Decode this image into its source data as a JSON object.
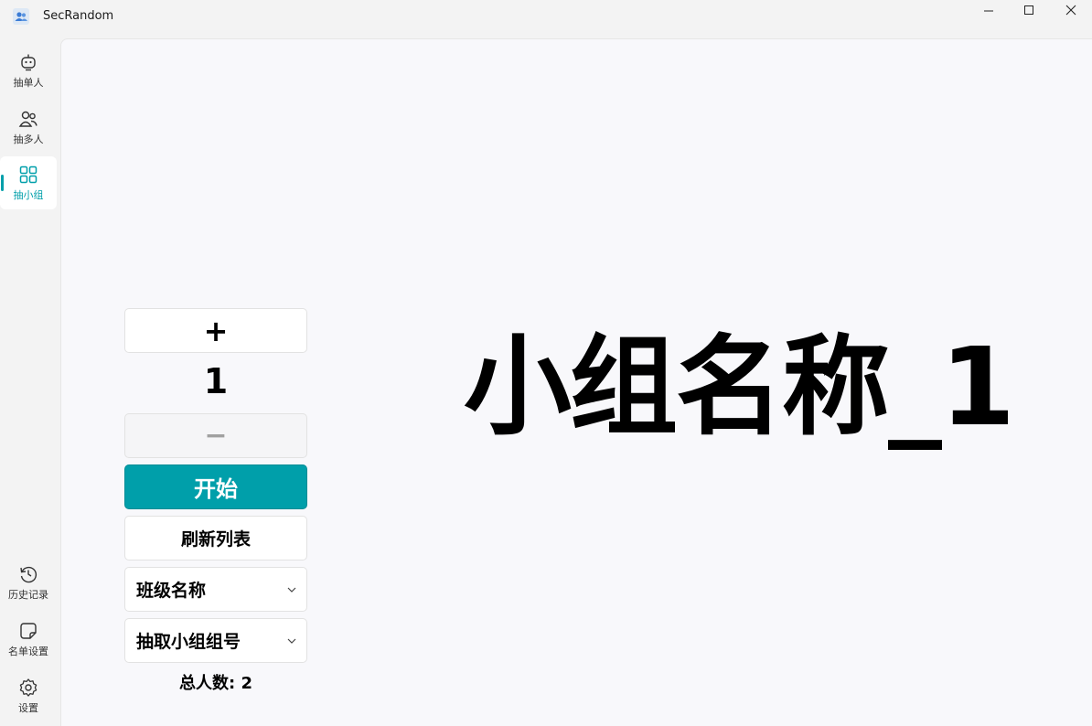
{
  "window": {
    "title": "SecRandom"
  },
  "sidebar": {
    "items_top": [
      {
        "label": "抽单人",
        "icon": "robot-icon"
      },
      {
        "label": "抽多人",
        "icon": "people-icon"
      },
      {
        "label": "抽小组",
        "icon": "group-grid-icon",
        "active": true
      }
    ],
    "items_bottom": [
      {
        "label": "历史记录",
        "icon": "history-icon"
      },
      {
        "label": "名单设置",
        "icon": "note-icon"
      },
      {
        "label": "设置",
        "icon": "gear-icon"
      }
    ]
  },
  "main": {
    "plus_label": "+",
    "count": "1",
    "minus_label": "−",
    "start_label": "开始",
    "refresh_label": "刷新列表",
    "class_select": "班级名称",
    "group_select": "抽取小组组号",
    "total_label": "总人数: 2",
    "result": "小组名称_1"
  },
  "colors": {
    "accent": "#009faa"
  }
}
